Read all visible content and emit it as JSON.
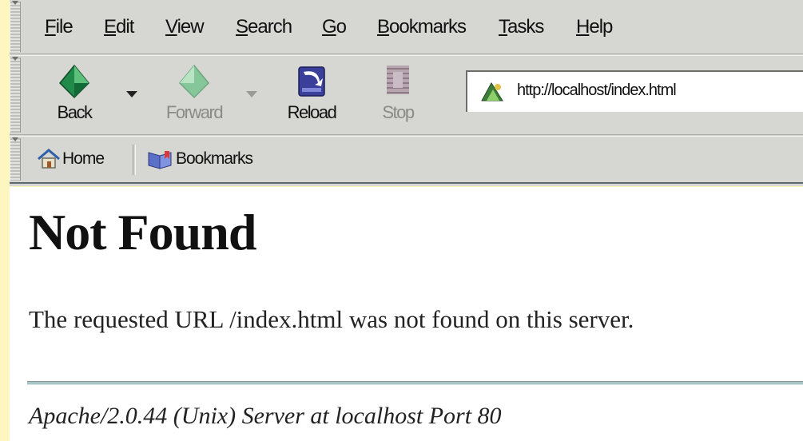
{
  "menubar": {
    "items": [
      {
        "label": "File",
        "accel": "F"
      },
      {
        "label": "Edit",
        "accel": "E"
      },
      {
        "label": "View",
        "accel": "V"
      },
      {
        "label": "Search",
        "accel": "S"
      },
      {
        "label": "Go",
        "accel": "G"
      },
      {
        "label": "Bookmarks",
        "accel": "B"
      },
      {
        "label": "Tasks",
        "accel": "T"
      },
      {
        "label": "Help",
        "accel": "H"
      }
    ]
  },
  "navbar": {
    "back_label": "Back",
    "forward_label": "Forward",
    "reload_label": "Reload",
    "stop_label": "Stop",
    "url": "http://localhost/index.html"
  },
  "personal_toolbar": {
    "home_label": "Home",
    "bookmarks_label": "Bookmarks"
  },
  "page": {
    "heading": "Not Found",
    "message": "The requested URL /index.html was not found on this server.",
    "address": "Apache/2.0.44 (Unix) Server at localhost Port 80"
  },
  "colors": {
    "desktop_background": "#fdf6c0",
    "chrome_background": "#d6d6d2",
    "page_background": "#ffffff"
  },
  "icons": [
    "back-arrow-icon",
    "dropdown-arrow-icon",
    "forward-arrow-icon",
    "reload-icon",
    "stop-icon",
    "site-icon",
    "home-icon",
    "bookmarks-icon"
  ]
}
